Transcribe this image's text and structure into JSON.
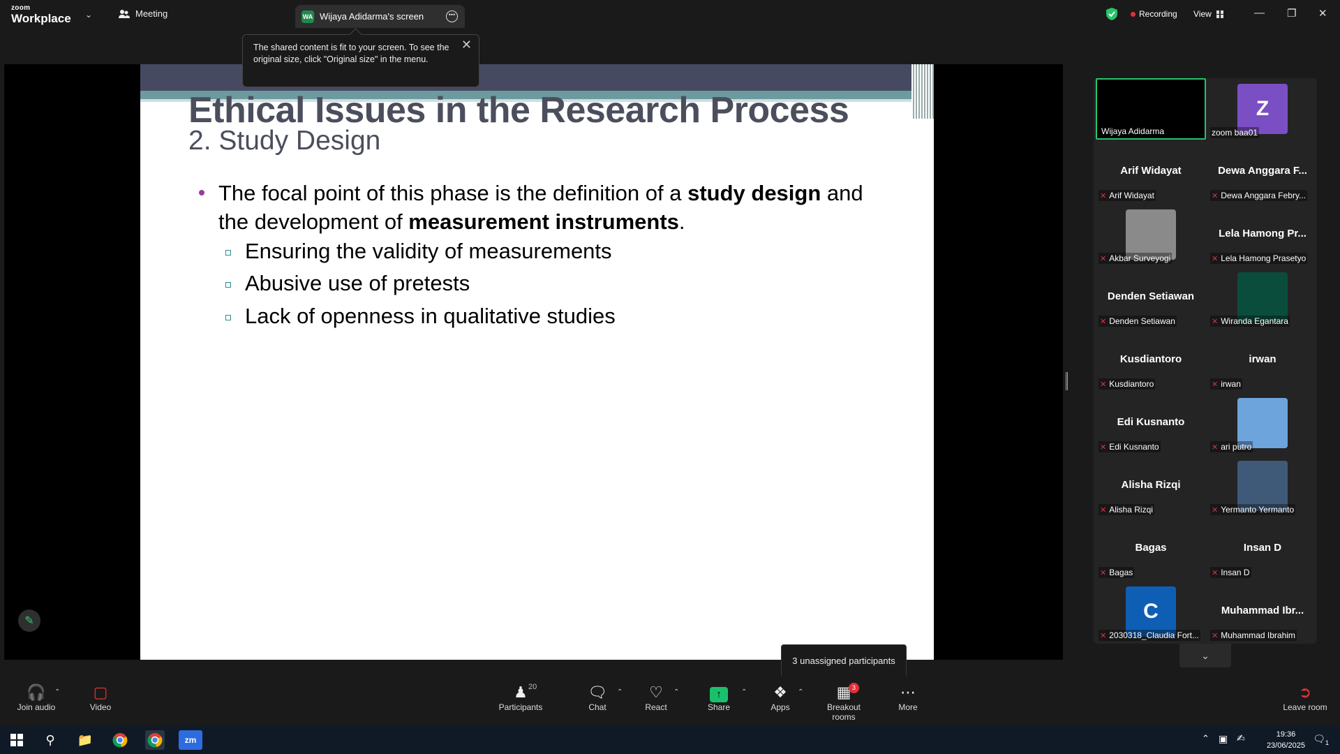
{
  "app": {
    "logo_line1": "zoom",
    "logo_line2": "Workplace",
    "meeting_label": "Meeting",
    "screen_tab_initials": "WA",
    "screen_tab_label": "Wijaya Adidarma's screen",
    "recording_label": "Recording",
    "view_label": "View"
  },
  "tooltip": {
    "text": "The shared content is fit to your screen. To see the original size, click \"Original size\" in the menu."
  },
  "slide": {
    "title": "Ethical Issues in the Research Process",
    "subtitle": "2. Study Design",
    "bullet_pre": "The focal point of this phase is the definition of a ",
    "bullet_bold1": "study design",
    "bullet_mid": " and the development of ",
    "bullet_bold2": "measurement instruments",
    "bullet_end": ".",
    "sub_bullets": [
      "Ensuring the validity of measurements",
      "Abusive use of pretests",
      "Lack of openness in qualitative studies"
    ]
  },
  "participants": [
    {
      "name": "",
      "label": "Wijaya Adidarma",
      "muted": false,
      "kind": "video-black"
    },
    {
      "name": "",
      "label": "zoom baa01",
      "muted": false,
      "kind": "avatar",
      "letter": "Z",
      "color": "#7b4fc4"
    },
    {
      "name": "Arif Widayat",
      "label": "Arif Widayat",
      "muted": true,
      "kind": "name"
    },
    {
      "name": "Dewa Anggara F...",
      "label": "Dewa Anggara Febry...",
      "muted": true,
      "kind": "name"
    },
    {
      "name": "",
      "label": "Akbar Surveyogi",
      "muted": true,
      "kind": "photo",
      "color": "#8a8a8a"
    },
    {
      "name": "Lela Hamong Pr...",
      "label": "Lela Hamong Prasetyo",
      "muted": true,
      "kind": "name"
    },
    {
      "name": "Denden Setiawan",
      "label": "Denden Setiawan",
      "muted": true,
      "kind": "name"
    },
    {
      "name": "",
      "label": "Wiranda Egantara",
      "muted": true,
      "kind": "photo",
      "color": "#0b4d3c"
    },
    {
      "name": "Kusdiantoro",
      "label": "Kusdiantoro",
      "muted": true,
      "kind": "name"
    },
    {
      "name": "irwan",
      "label": "irwan",
      "muted": true,
      "kind": "name"
    },
    {
      "name": "Edi Kusnanto",
      "label": "Edi Kusnanto",
      "muted": true,
      "kind": "name"
    },
    {
      "name": "",
      "label": "ari putro",
      "muted": true,
      "kind": "photo",
      "color": "#6ea4dc"
    },
    {
      "name": "Alisha Rizqi",
      "label": "Alisha Rizqi",
      "muted": true,
      "kind": "name"
    },
    {
      "name": "",
      "label": "Yermanto Yermanto",
      "muted": true,
      "kind": "photo",
      "color": "#3e5a78"
    },
    {
      "name": "Bagas",
      "label": "Bagas",
      "muted": true,
      "kind": "name"
    },
    {
      "name": "Insan D",
      "label": "Insan D",
      "muted": true,
      "kind": "name"
    },
    {
      "name": "",
      "label": "2030318_Claudia Fort...",
      "muted": true,
      "kind": "avatar",
      "letter": "C",
      "color": "#0e5fb4"
    },
    {
      "name": "Muhammad Ibr...",
      "label": "Muhammad Ibrahim",
      "muted": true,
      "kind": "name"
    }
  ],
  "breakout_tooltip": "3 unassigned participants",
  "toolbar": {
    "join_audio": "Join audio",
    "video": "Video",
    "participants": "Participants",
    "participants_count": "20",
    "chat": "Chat",
    "react": "React",
    "share": "Share",
    "apps": "Apps",
    "breakout_rooms": "Breakout rooms",
    "breakout_badge": "3",
    "more": "More",
    "leave_room": "Leave room"
  },
  "taskbar": {
    "time": "19:36",
    "date": "23/06/2025",
    "notif_count": "1"
  }
}
